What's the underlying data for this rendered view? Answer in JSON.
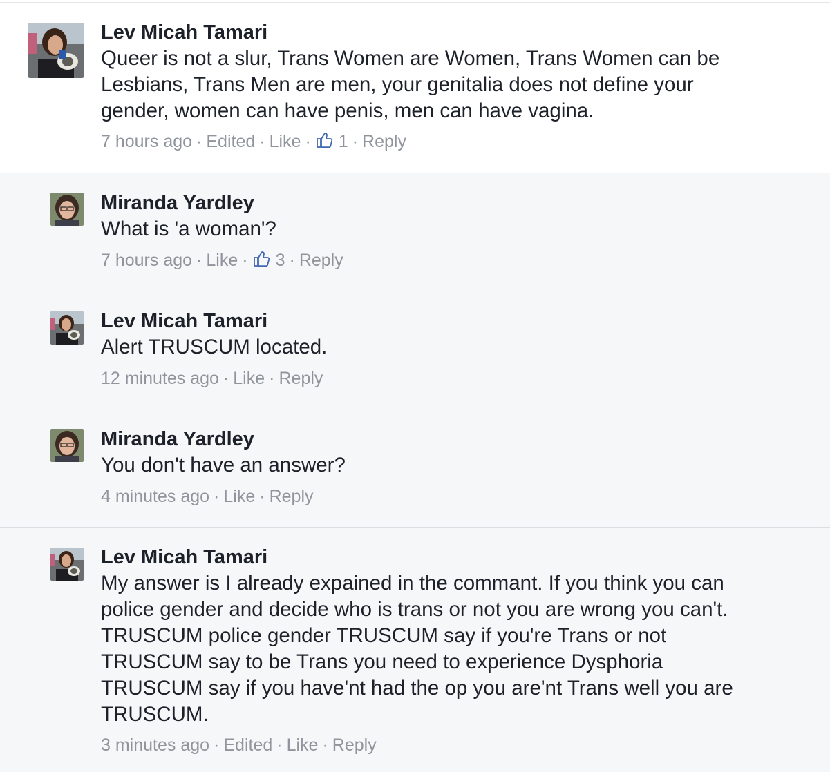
{
  "comments": [
    {
      "author": "Lev Micah Tamari",
      "text": "Queer is not a slur, Trans Women are Women, Trans Women can be\nLesbians, Trans Men are men, your genitalia does not define your\ngender, women can have penis, men can have vagina.",
      "time": "7 hours ago",
      "edited": "Edited",
      "like": "Like",
      "like_count": "1",
      "reply": "Reply"
    },
    {
      "author": "Miranda Yardley",
      "text": "What is 'a woman'?",
      "time": "7 hours ago",
      "like": "Like",
      "like_count": "3",
      "reply": "Reply"
    },
    {
      "author": "Lev Micah Tamari",
      "text": "Alert TRUSCUM located.",
      "time": "12 minutes ago",
      "like": "Like",
      "reply": "Reply"
    },
    {
      "author": "Miranda Yardley",
      "text": "You don't have an answer?",
      "time": "4 minutes ago",
      "like": "Like",
      "reply": "Reply"
    },
    {
      "author": "Lev Micah Tamari",
      "text": "My answer is I already expained in the commant. If you think you can\npolice gender and decide who is trans or not you are wrong you can't.\nTRUSCUM police gender TRUSCUM say if you're Trans or not\nTRUSCUM say to be Trans you need to experience Dysphoria\nTRUSCUM say if you have'nt had the op you are'nt Trans well you are\nTRUSCUM.",
      "time": "3 minutes ago",
      "edited": "Edited",
      "like": "Like",
      "reply": "Reply"
    }
  ],
  "separator": "·",
  "icons": {
    "like": "thumbs-up-icon",
    "avatar_lev": "avatar-megaphone-photo",
    "avatar_miranda": "avatar-portrait-photo"
  },
  "colors": {
    "text": "#1d2129",
    "meta": "#90949c",
    "reply_bg": "#f6f7f9",
    "thumb": "#4267b2"
  }
}
